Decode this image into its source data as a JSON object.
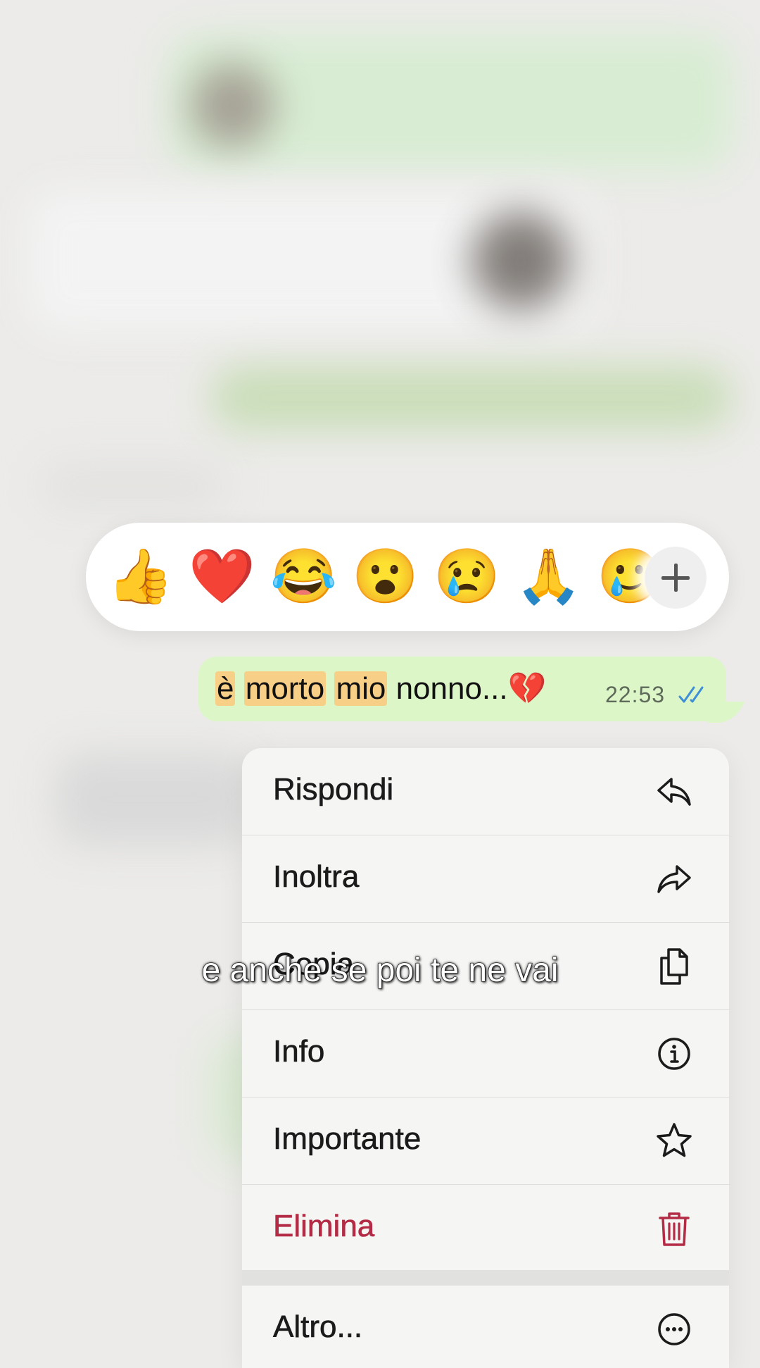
{
  "reactions": {
    "emojis": [
      "👍",
      "❤️",
      "😂",
      "😮",
      "😢",
      "🙏",
      "🥲"
    ],
    "more_icon": "plus-icon"
  },
  "message": {
    "word1": "è",
    "word2": "morto",
    "word3": "mio",
    "rest": "nonno...",
    "emoji": "💔",
    "time": "22:53",
    "status_icon": "double-check-icon",
    "highlight_color": "#f7cf86",
    "bubble_color": "#dcf6c8"
  },
  "menu": {
    "items": [
      {
        "label": "Rispondi",
        "icon": "reply-icon"
      },
      {
        "label": "Inoltra",
        "icon": "forward-icon"
      },
      {
        "label": "Copia",
        "icon": "copy-icon"
      },
      {
        "label": "Info",
        "icon": "info-icon"
      },
      {
        "label": "Importante",
        "icon": "star-icon"
      },
      {
        "label": "Elimina",
        "icon": "trash-icon"
      },
      {
        "label": "Altro...",
        "icon": "more-icon"
      }
    ],
    "danger_color": "#b42b45"
  },
  "caption": "e anche se poi te ne vai"
}
